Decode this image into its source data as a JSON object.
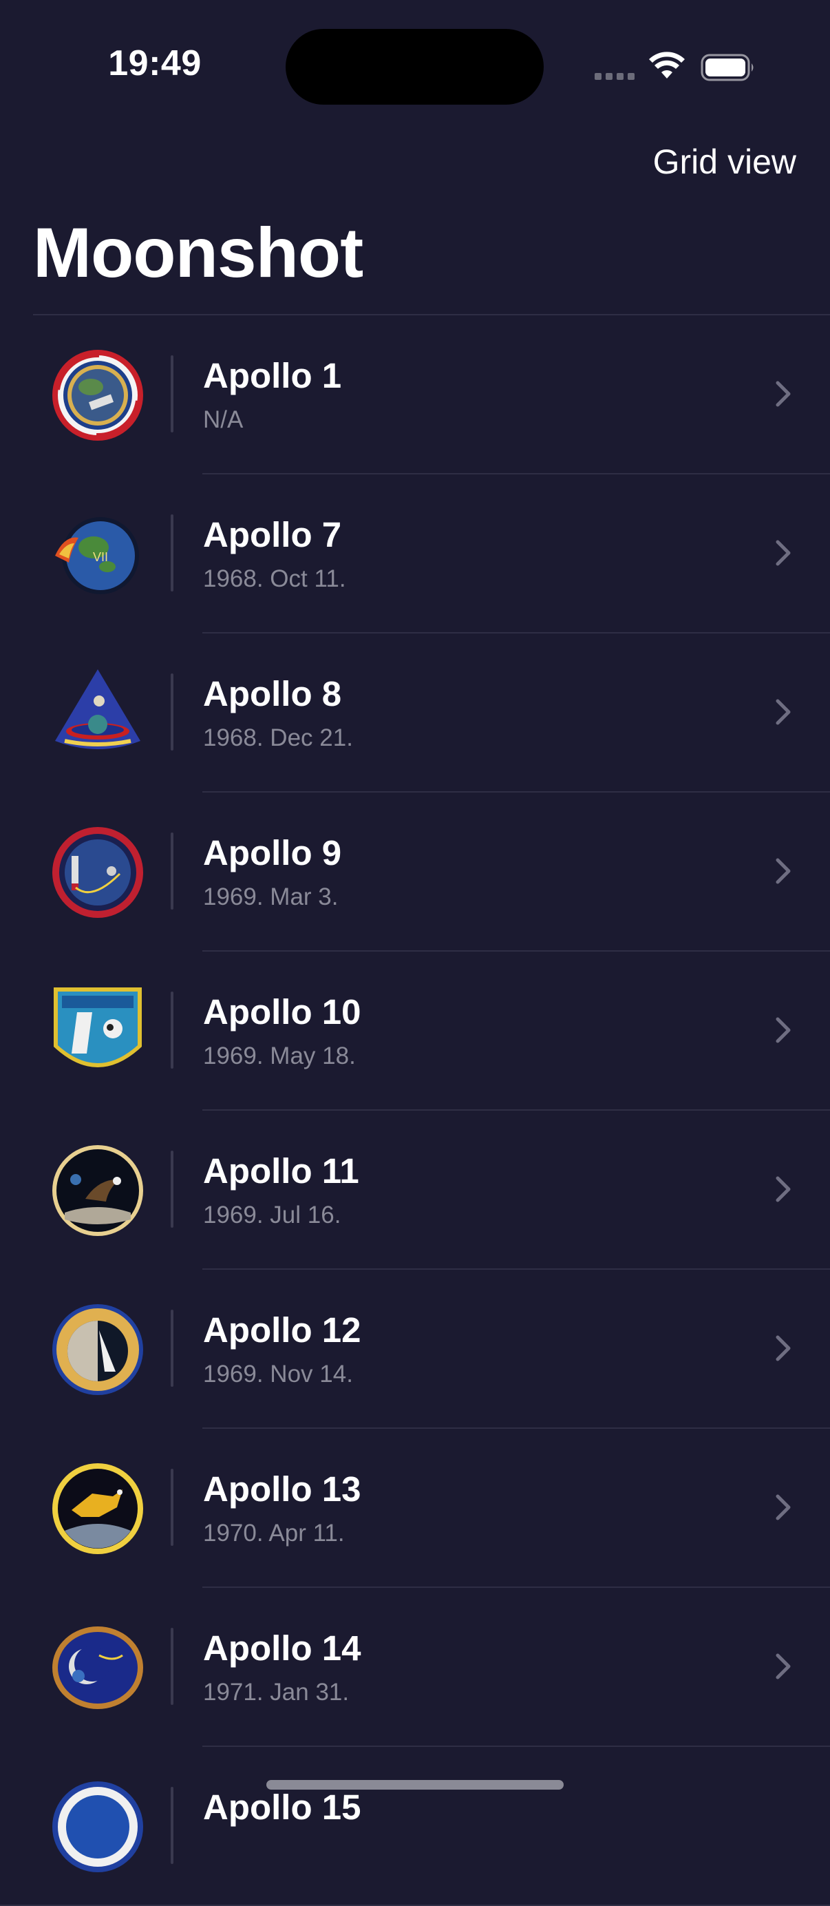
{
  "status_bar": {
    "time": "19:49"
  },
  "nav": {
    "grid_view_label": "Grid view",
    "title": "Moonshot"
  },
  "missions": [
    {
      "name": "Apollo 1",
      "date": "N/A",
      "badge_icon": "apollo-1-patch-icon"
    },
    {
      "name": "Apollo 7",
      "date": "1968. Oct 11.",
      "badge_icon": "apollo-7-patch-icon"
    },
    {
      "name": "Apollo 8",
      "date": "1968. Dec 21.",
      "badge_icon": "apollo-8-patch-icon"
    },
    {
      "name": "Apollo 9",
      "date": "1969. Mar 3.",
      "badge_icon": "apollo-9-patch-icon"
    },
    {
      "name": "Apollo 10",
      "date": "1969. May 18.",
      "badge_icon": "apollo-10-patch-icon"
    },
    {
      "name": "Apollo 11",
      "date": "1969. Jul 16.",
      "badge_icon": "apollo-11-patch-icon"
    },
    {
      "name": "Apollo 12",
      "date": "1969. Nov 14.",
      "badge_icon": "apollo-12-patch-icon"
    },
    {
      "name": "Apollo 13",
      "date": "1970. Apr 11.",
      "badge_icon": "apollo-13-patch-icon"
    },
    {
      "name": "Apollo 14",
      "date": "1971. Jan 31.",
      "badge_icon": "apollo-14-patch-icon"
    },
    {
      "name": "Apollo 15",
      "date": "",
      "badge_icon": "apollo-15-patch-icon"
    }
  ],
  "colors": {
    "background": "#1b1a30",
    "separator": "#2f2e45",
    "secondary_text": "#8a8a98",
    "chevron": "#6f6e82"
  }
}
